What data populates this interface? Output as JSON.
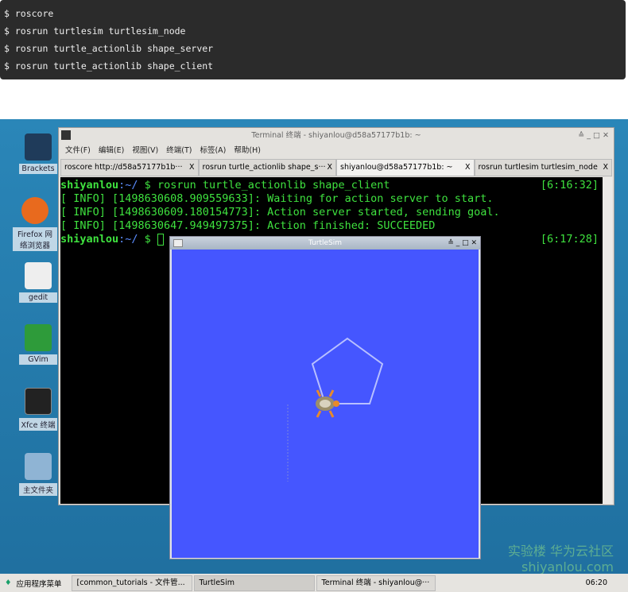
{
  "code_block": {
    "lines": [
      "$ roscore",
      "$ rosrun turtlesim turtlesim_node",
      "$ rosrun turtle_actionlib shape_server",
      "$ rosrun turtle_actionlib shape_client"
    ]
  },
  "desktop_icons": [
    {
      "label": "Brackets",
      "color": "#1f3b5a"
    },
    {
      "label": "Firefox 网络浏览器",
      "color": "#e86a1e"
    },
    {
      "label": "gedit",
      "color": "#eee"
    },
    {
      "label": "GVim",
      "color": "#2e9b3a"
    },
    {
      "label": "Xfce 终端",
      "color": "#222"
    },
    {
      "label": "主文件夹",
      "color": "#8fb4d4"
    }
  ],
  "terminal": {
    "title": "Terminal 终端 - shiyanlou@d58a57177b1b: ~",
    "menu": [
      "文件(F)",
      "编辑(E)",
      "视图(V)",
      "终端(T)",
      "标签(A)",
      "帮助(H)"
    ],
    "tabs": [
      {
        "label": "roscore http://d58a57177b1b···",
        "close": "X"
      },
      {
        "label": "rosrun turtle_actionlib shape_s···",
        "close": "X"
      },
      {
        "label": "shiyanlou@d58a57177b1b: ~",
        "close": "X"
      },
      {
        "label": "rosrun turtlesim turtlesim_node",
        "close": "X"
      }
    ],
    "user": "shiyanlou",
    "path": ":~/",
    "prompt": " $ ",
    "cmd": "rosrun turtle_actionlib shape_client",
    "time1": "[6:16:32]",
    "info": [
      "[ INFO] [1498630608.909559633]: Waiting for action server to start.",
      "[ INFO] [1498630609.180154773]: Action server started, sending goal.",
      "[ INFO] [1498630647.949497375]: Action finished: SUCCEEDED"
    ],
    "time2": "[6:17:28]"
  },
  "turtlesim": {
    "title": "TurtleSim",
    "bg": "#4556ff"
  },
  "taskbar": {
    "menu": "应用程序菜单",
    "items": [
      "[common_tutorials - 文件管...",
      "TurtleSim",
      "Terminal 终端 - shiyanlou@···"
    ],
    "clock": "06:20"
  },
  "watermark": {
    "text": "实验楼 华为云社区 shiyanlou.com"
  }
}
